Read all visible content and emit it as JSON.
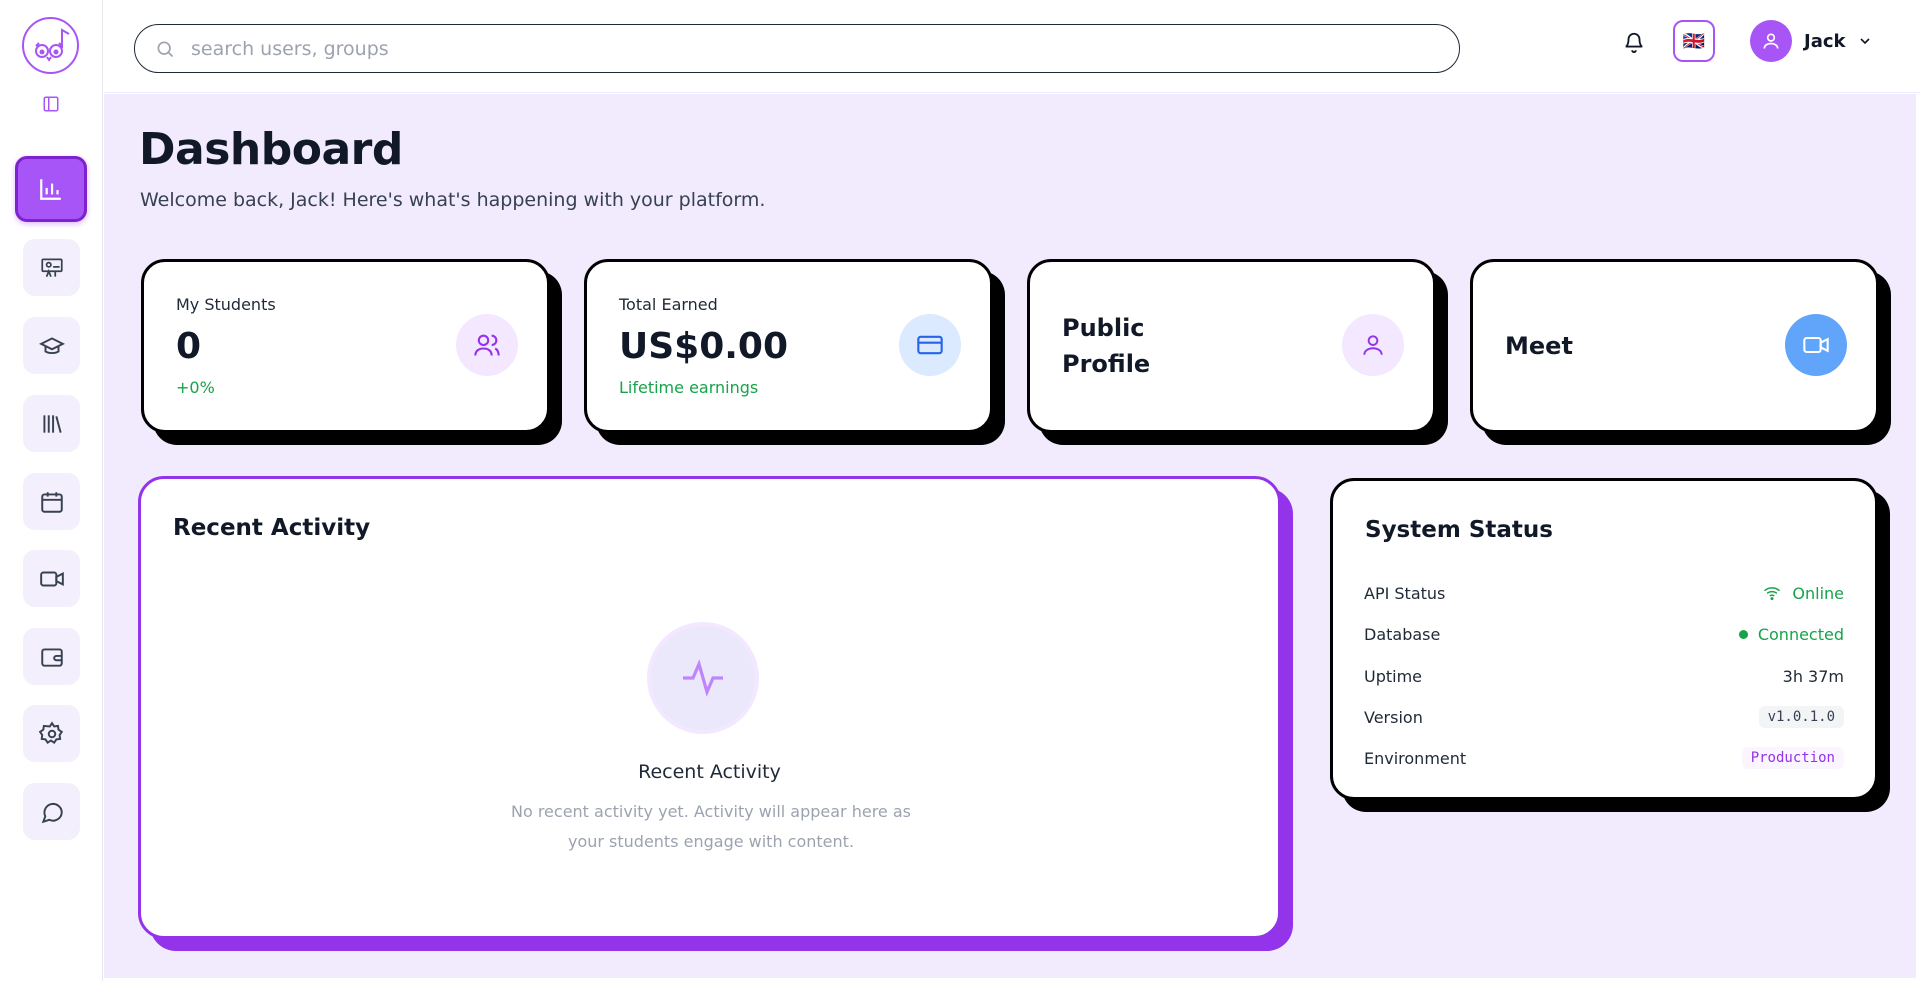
{
  "sidebar": {
    "logo_icon": "owl-music-logo",
    "collapse_icon": "sidebar-toggle-icon",
    "items": [
      {
        "icon": "bar-chart-icon",
        "active": true
      },
      {
        "icon": "presentation-icon",
        "active": false
      },
      {
        "icon": "graduation-cap-icon",
        "active": false
      },
      {
        "icon": "library-icon",
        "active": false
      },
      {
        "icon": "calendar-icon",
        "active": false
      },
      {
        "icon": "video-icon",
        "active": false
      },
      {
        "icon": "wallet-icon",
        "active": false
      },
      {
        "icon": "settings-icon",
        "active": false
      },
      {
        "icon": "chat-icon",
        "active": false
      }
    ]
  },
  "topbar": {
    "search_placeholder": "search users, groups",
    "language_flag": "🇬🇧",
    "user_name": "Jack"
  },
  "page": {
    "title": "Dashboard",
    "subtitle": "Welcome back, Jack! Here's what's happening with your platform."
  },
  "stats": {
    "students": {
      "label": "My Students",
      "value": "0",
      "sub": "+0%"
    },
    "earned": {
      "label": "Total Earned",
      "value": "US$0.00",
      "sub": "Lifetime earnings"
    },
    "profile": {
      "line1": "Public",
      "line2": "Profile"
    },
    "meet": {
      "title": "Meet"
    }
  },
  "activity": {
    "title": "Recent Activity",
    "empty_title": "Recent Activity",
    "empty_desc": "No recent activity yet. Activity will appear here as your students engage with content."
  },
  "system_status": {
    "title": "System Status",
    "rows": [
      {
        "label": "API Status",
        "value": "Online"
      },
      {
        "label": "Database",
        "value": "Connected"
      },
      {
        "label": "Uptime",
        "value": "3h 37m"
      },
      {
        "label": "Version",
        "value": "v1.0.1.0"
      },
      {
        "label": "Environment",
        "value": "Production"
      }
    ]
  },
  "colors": {
    "accent": "#a855f7",
    "accent_dark": "#9333ea",
    "background": "#f1ebfd",
    "success": "#16a34a",
    "info_blue": "#60a5fa"
  }
}
